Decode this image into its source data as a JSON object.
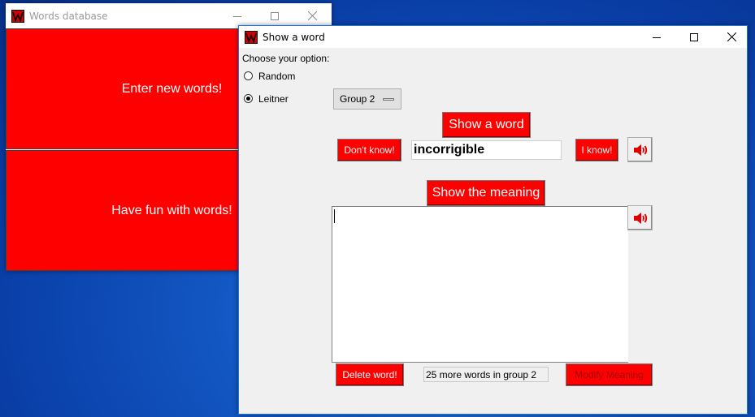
{
  "main_window": {
    "title": "Words database",
    "enter_button": "Enter new words!",
    "fun_button": "Have fun with words!"
  },
  "show_window": {
    "title": "Show a word",
    "choose_label": "Choose your option:",
    "options": [
      {
        "label": "Random",
        "selected": false
      },
      {
        "label": "Leitner",
        "selected": true
      }
    ],
    "group_menu": "Group 2",
    "show_word_button": "Show a word",
    "dont_know_button": "Don't know!",
    "word": "incorrigible",
    "i_know_button": "I know!",
    "show_meaning_button": "Show the meaning",
    "meaning_text": "",
    "delete_button": "Delete word!",
    "status": "25 more words in group 2",
    "modify_button": "Modify Meaning"
  },
  "colors": {
    "button_red": "#ff0000",
    "desktop_blue": "#0a3fa8",
    "window_bg": "#f0f0f0"
  },
  "icons": [
    "app-icon",
    "minimize-icon",
    "maximize-icon",
    "close-icon",
    "speaker-icon"
  ]
}
